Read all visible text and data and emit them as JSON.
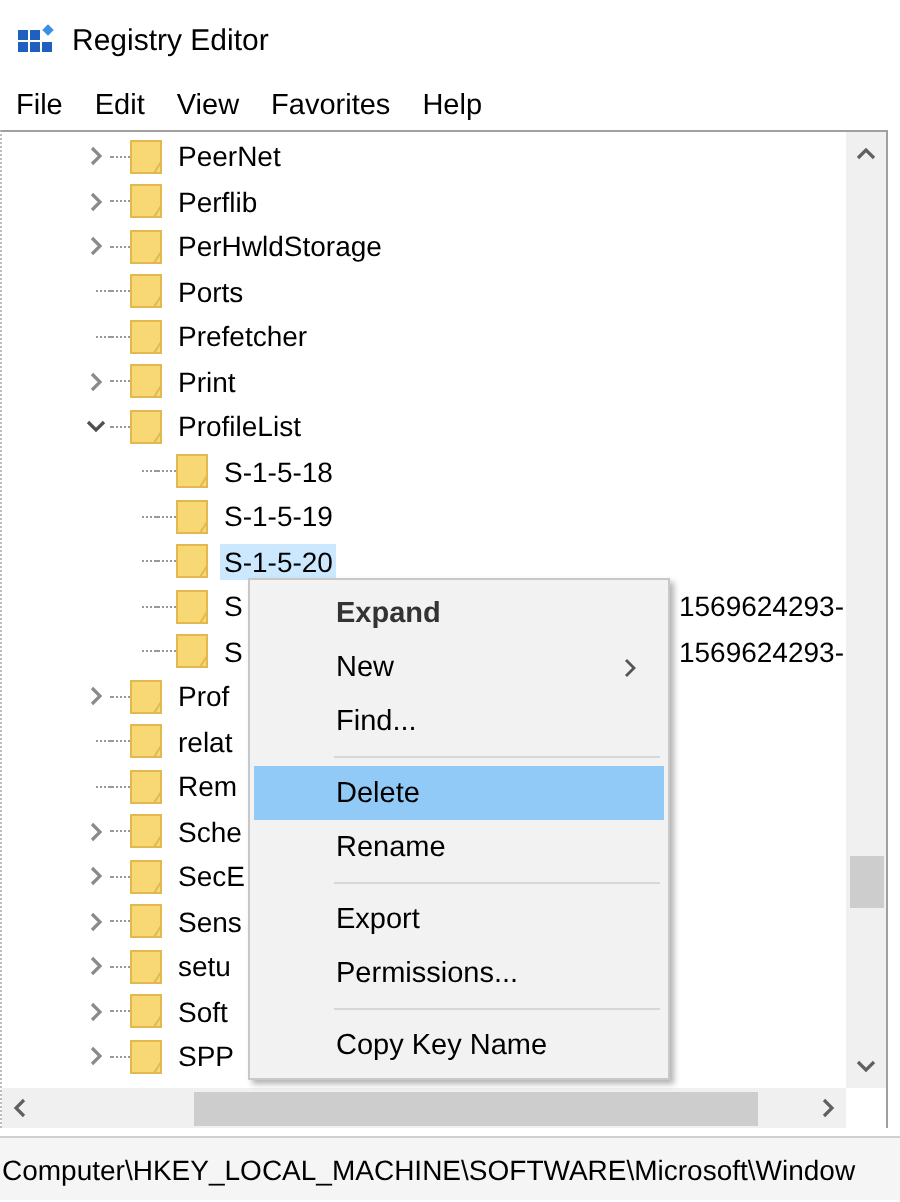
{
  "window": {
    "title": "Registry Editor"
  },
  "menu_bar": [
    "File",
    "Edit",
    "View",
    "Favorites",
    "Help"
  ],
  "tree": [
    {
      "label": "PeerNet",
      "kind": "collapsed",
      "selected": false
    },
    {
      "label": "Perflib",
      "kind": "collapsed",
      "selected": false
    },
    {
      "label": "PerHwldStorage",
      "kind": "collapsed",
      "selected": false
    },
    {
      "label": "Ports",
      "kind": "leaf",
      "selected": false
    },
    {
      "label": "Prefetcher",
      "kind": "leaf",
      "selected": false
    },
    {
      "label": "Print",
      "kind": "collapsed",
      "selected": false
    },
    {
      "label": "ProfileList",
      "kind": "expanded",
      "selected": false,
      "children": [
        {
          "label": "S-1-5-18",
          "kind": "leaf",
          "selected": false
        },
        {
          "label": "S-1-5-19",
          "kind": "leaf",
          "selected": false
        },
        {
          "label": "S-1-5-20",
          "kind": "leaf",
          "selected": true
        },
        {
          "label": "S",
          "label_end": "1569624293-",
          "kind": "leaf",
          "selected": false
        },
        {
          "label": "S",
          "label_end": "1569624293-",
          "kind": "leaf",
          "selected": false
        }
      ]
    },
    {
      "label": "Prof",
      "kind": "collapsed",
      "selected": false
    },
    {
      "label": "relat",
      "kind": "leaf",
      "selected": false
    },
    {
      "label": "Rem",
      "kind": "leaf",
      "selected": false
    },
    {
      "label": "Sche",
      "kind": "collapsed",
      "selected": false
    },
    {
      "label": "SecE",
      "kind": "collapsed",
      "selected": false
    },
    {
      "label": "Sens",
      "kind": "collapsed",
      "selected": false
    },
    {
      "label": "setu",
      "kind": "collapsed",
      "selected": false
    },
    {
      "label": "Soft",
      "kind": "collapsed",
      "selected": false
    },
    {
      "label": "SPP",
      "kind": "collapsed",
      "selected": false
    }
  ],
  "context_menu": [
    {
      "kind": "item",
      "label": "Expand",
      "default": true,
      "submenu": false,
      "selected": false
    },
    {
      "kind": "item",
      "label": "New",
      "default": false,
      "submenu": true,
      "selected": false
    },
    {
      "kind": "item",
      "label": "Find...",
      "default": false,
      "submenu": false,
      "selected": false
    },
    {
      "kind": "separator"
    },
    {
      "kind": "item",
      "label": "Delete",
      "default": false,
      "submenu": false,
      "selected": true
    },
    {
      "kind": "item",
      "label": "Rename",
      "default": false,
      "submenu": false,
      "selected": false
    },
    {
      "kind": "separator"
    },
    {
      "kind": "item",
      "label": "Export",
      "default": false,
      "submenu": false,
      "selected": false
    },
    {
      "kind": "item",
      "label": "Permissions...",
      "default": false,
      "submenu": false,
      "selected": false
    },
    {
      "kind": "separator"
    },
    {
      "kind": "item",
      "label": "Copy Key Name",
      "default": false,
      "submenu": false,
      "selected": false
    }
  ],
  "status_bar": "Computer\\HKEY_LOCAL_MACHINE\\SOFTWARE\\Microsoft\\Window"
}
